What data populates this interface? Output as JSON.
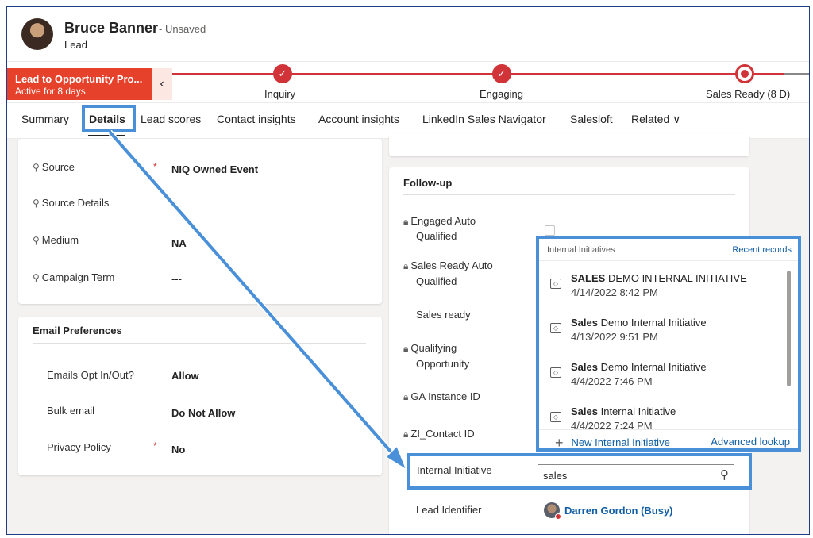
{
  "header": {
    "name": "Bruce Banner",
    "status": "- Unsaved",
    "entity": "Lead"
  },
  "bpf": {
    "process_name": "Lead to Opportunity Pro...",
    "active_for": "Active for 8 days",
    "collapse_glyph": "‹",
    "stages": [
      {
        "label": "Inquiry",
        "state": "complete",
        "glyph": "✓"
      },
      {
        "label": "Engaging",
        "state": "complete",
        "glyph": "✓"
      },
      {
        "label": "Sales Ready  (8 D)",
        "state": "active",
        "glyph": ""
      }
    ],
    "accent": "#d13438",
    "flag_color": "#e5412b"
  },
  "tabs": [
    {
      "label": "Summary"
    },
    {
      "label": "Details",
      "selected": true
    },
    {
      "label": "Lead scores"
    },
    {
      "label": "Contact insights"
    },
    {
      "label": "Account insights"
    },
    {
      "label": "LinkedIn Sales Navigator"
    },
    {
      "label": "Salesloft"
    },
    {
      "label": "Related ∨"
    }
  ],
  "source_section": {
    "fields": [
      {
        "label": "Source",
        "value": "NIQ Owned Event",
        "required": "*",
        "icon": "search-icon"
      },
      {
        "label": "Source Details",
        "value": "---",
        "icon": "search-icon"
      },
      {
        "label": "Medium",
        "value": "NA",
        "icon": "search-icon"
      },
      {
        "label": "Campaign Term",
        "value": "---",
        "icon": "search-icon"
      }
    ]
  },
  "email_section": {
    "title": "Email Preferences",
    "fields": [
      {
        "label": "Emails Opt In/Out?",
        "value": "Allow"
      },
      {
        "label": "Bulk email",
        "value": "Do Not Allow"
      },
      {
        "label": "Privacy Policy",
        "value": "No",
        "required": "*"
      }
    ]
  },
  "followup_section": {
    "title": "Follow-up",
    "fields": [
      {
        "label_line1": "Engaged Auto",
        "label_line2": "Qualified",
        "icon": "lock-icon"
      },
      {
        "label_line1": "Sales Ready Auto",
        "label_line2": "Qualified",
        "icon": "lock-icon"
      },
      {
        "label_line1": "Sales ready",
        "label_line2": ""
      },
      {
        "label_line1": "Qualifying",
        "label_line2": "Opportunity",
        "icon": "lock-icon"
      },
      {
        "label_line1": "GA Instance ID",
        "label_line2": "",
        "icon": "lock-icon"
      },
      {
        "label_line1": "ZI_Contact ID",
        "label_line2": "",
        "icon": "lock-icon"
      }
    ],
    "internal_initiative": {
      "label": "Internal Initiative",
      "value": "sales"
    },
    "lead_identifier": {
      "label": "Lead Identifier",
      "value": "Darren Gordon (Busy)"
    }
  },
  "lookup_dropdown": {
    "header_left": "Internal Initiatives",
    "header_right": "Recent records",
    "items": [
      {
        "bold": "SALES",
        "rest": " DEMO INTERNAL INITIATIVE",
        "date": "4/14/2022 8:42 PM"
      },
      {
        "bold": "Sales",
        "rest": " Demo Internal Initiative",
        "date": "4/13/2022 9:51 PM"
      },
      {
        "bold": "Sales",
        "rest": " Demo Internal Initiative",
        "date": "4/4/2022 7:46 PM"
      },
      {
        "bold": "Sales",
        "rest": " Internal Initiative",
        "date": "4/4/2022 7:24 PM"
      }
    ],
    "new_label": "New Internal Initiative",
    "advanced_label": "Advanced lookup"
  },
  "annotation_color": "#4a90d9"
}
